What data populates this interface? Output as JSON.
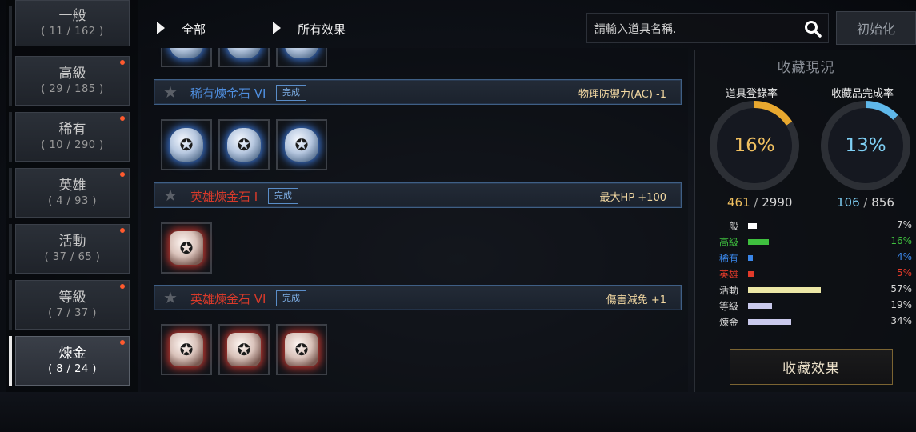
{
  "categories": [
    {
      "name": "一般",
      "count": "( 11 / 162 )",
      "alert": false,
      "active": false
    },
    {
      "name": "高級",
      "count": "( 29 / 185 )",
      "alert": true,
      "active": false
    },
    {
      "name": "稀有",
      "count": "( 10 / 290 )",
      "alert": true,
      "active": false
    },
    {
      "name": "英雄",
      "count": "( 4 / 93 )",
      "alert": true,
      "active": false
    },
    {
      "name": "活動",
      "count": "( 37 / 65 )",
      "alert": true,
      "active": false
    },
    {
      "name": "等級",
      "count": "( 7 / 37 )",
      "alert": true,
      "active": false
    },
    {
      "name": "煉金",
      "count": "( 8 / 24 )",
      "alert": true,
      "active": true
    }
  ],
  "filters": {
    "scope": "全部",
    "effect": "所有效果"
  },
  "search": {
    "placeholder": "請輸入道具名稱."
  },
  "reset_label": "初始化",
  "groups": [
    {
      "name": "稀有煉金石 VI",
      "grade": "rare",
      "status": "完成",
      "effect": "物理防禦力(AC) -1",
      "items": 3,
      "gem_color": "blue"
    },
    {
      "name": "英雄煉金石 I",
      "grade": "hero",
      "status": "完成",
      "effect": "最大HP +100",
      "items": 1,
      "gem_color": "red"
    },
    {
      "name": "英雄煉金石 VI",
      "grade": "hero",
      "status": "完成",
      "effect": "傷害減免 +1",
      "items": 3,
      "gem_color": "red"
    }
  ],
  "summary": {
    "title": "收藏現況",
    "register": {
      "label": "道具登錄率",
      "percent": "16%",
      "current": "461",
      "total": "2990",
      "fraction": 0.16,
      "color": "#e8a82f"
    },
    "complete": {
      "label": "收藏品完成率",
      "percent": "13%",
      "current": "106",
      "total": "856",
      "fraction": 0.13,
      "color": "#5fb8ea"
    },
    "stats": [
      {
        "label": "一般",
        "pct": "7%",
        "fraction": 0.07,
        "color": "#ffffff",
        "text_color": "#d8d8d8"
      },
      {
        "label": "高級",
        "pct": "16%",
        "fraction": 0.16,
        "color": "#3fc03f",
        "text_color": "#3fc03f"
      },
      {
        "label": "稀有",
        "pct": "4%",
        "fraction": 0.04,
        "color": "#3a86e8",
        "text_color": "#3a86e8"
      },
      {
        "label": "英雄",
        "pct": "5%",
        "fraction": 0.05,
        "color": "#e23a2a",
        "text_color": "#e23a2a"
      },
      {
        "label": "活動",
        "pct": "57%",
        "fraction": 0.57,
        "color": "#ece7a6",
        "text_color": "#d8d8d8"
      },
      {
        "label": "等級",
        "pct": "19%",
        "fraction": 0.19,
        "color": "#c9c9ec",
        "text_color": "#d8d8d8"
      },
      {
        "label": "煉金",
        "pct": "34%",
        "fraction": 0.34,
        "color": "#c9c9ec",
        "text_color": "#d8d8d8"
      }
    ],
    "effect_button": "收藏效果"
  }
}
